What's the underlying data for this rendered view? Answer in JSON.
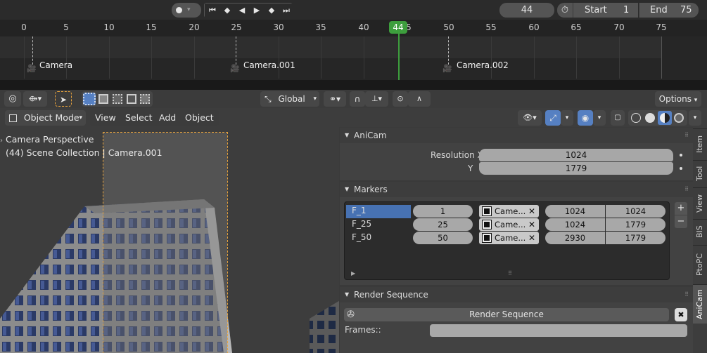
{
  "timeline": {
    "current_frame": "44",
    "start_label": "Start",
    "start_value": "1",
    "end_label": "End",
    "end_value": "75",
    "ticks": [
      "0",
      "5",
      "10",
      "15",
      "20",
      "25",
      "30",
      "35",
      "40",
      "44",
      "5",
      "50",
      "55",
      "60",
      "65",
      "70",
      "75"
    ],
    "markers": [
      "Camera",
      "Camera.001",
      "Camera.002"
    ]
  },
  "toolbar": {
    "transform_orientation": "Global",
    "options_label": "Options"
  },
  "header": {
    "mode": "Object Mode",
    "menus": [
      "View",
      "Select",
      "Add",
      "Object"
    ]
  },
  "viewport": {
    "line1": "Camera Perspective",
    "line2": "(44) Scene Collection | Camera.001"
  },
  "anicam_panel": {
    "title": "AniCam",
    "res_x_label": "Resolution X",
    "res_x_value": "1024",
    "res_y_label": "Y",
    "res_y_value": "1779"
  },
  "markers_panel": {
    "title": "Markers",
    "rows": [
      {
        "name": "F_1",
        "frame": "1",
        "camera": "Came...",
        "w": "1024",
        "h": "1024"
      },
      {
        "name": "F_25",
        "frame": "25",
        "camera": "Came...",
        "w": "1024",
        "h": "1779"
      },
      {
        "name": "F_50",
        "frame": "50",
        "camera": "Came...",
        "w": "2930",
        "h": "1779"
      }
    ],
    "add_symbol": "+",
    "remove_symbol": "−"
  },
  "render_panel": {
    "title": "Render Sequence",
    "button_label": "Render Sequence",
    "frames_label": "Frames::",
    "frames_value": ""
  },
  "side_tabs": [
    "Item",
    "Tool",
    "View",
    "BIS",
    "PtoPC",
    "AniCam"
  ],
  "colors": {
    "accent_green": "#3d9e3d",
    "selection_blue": "#5680c2",
    "panel_bg": "#424242"
  }
}
